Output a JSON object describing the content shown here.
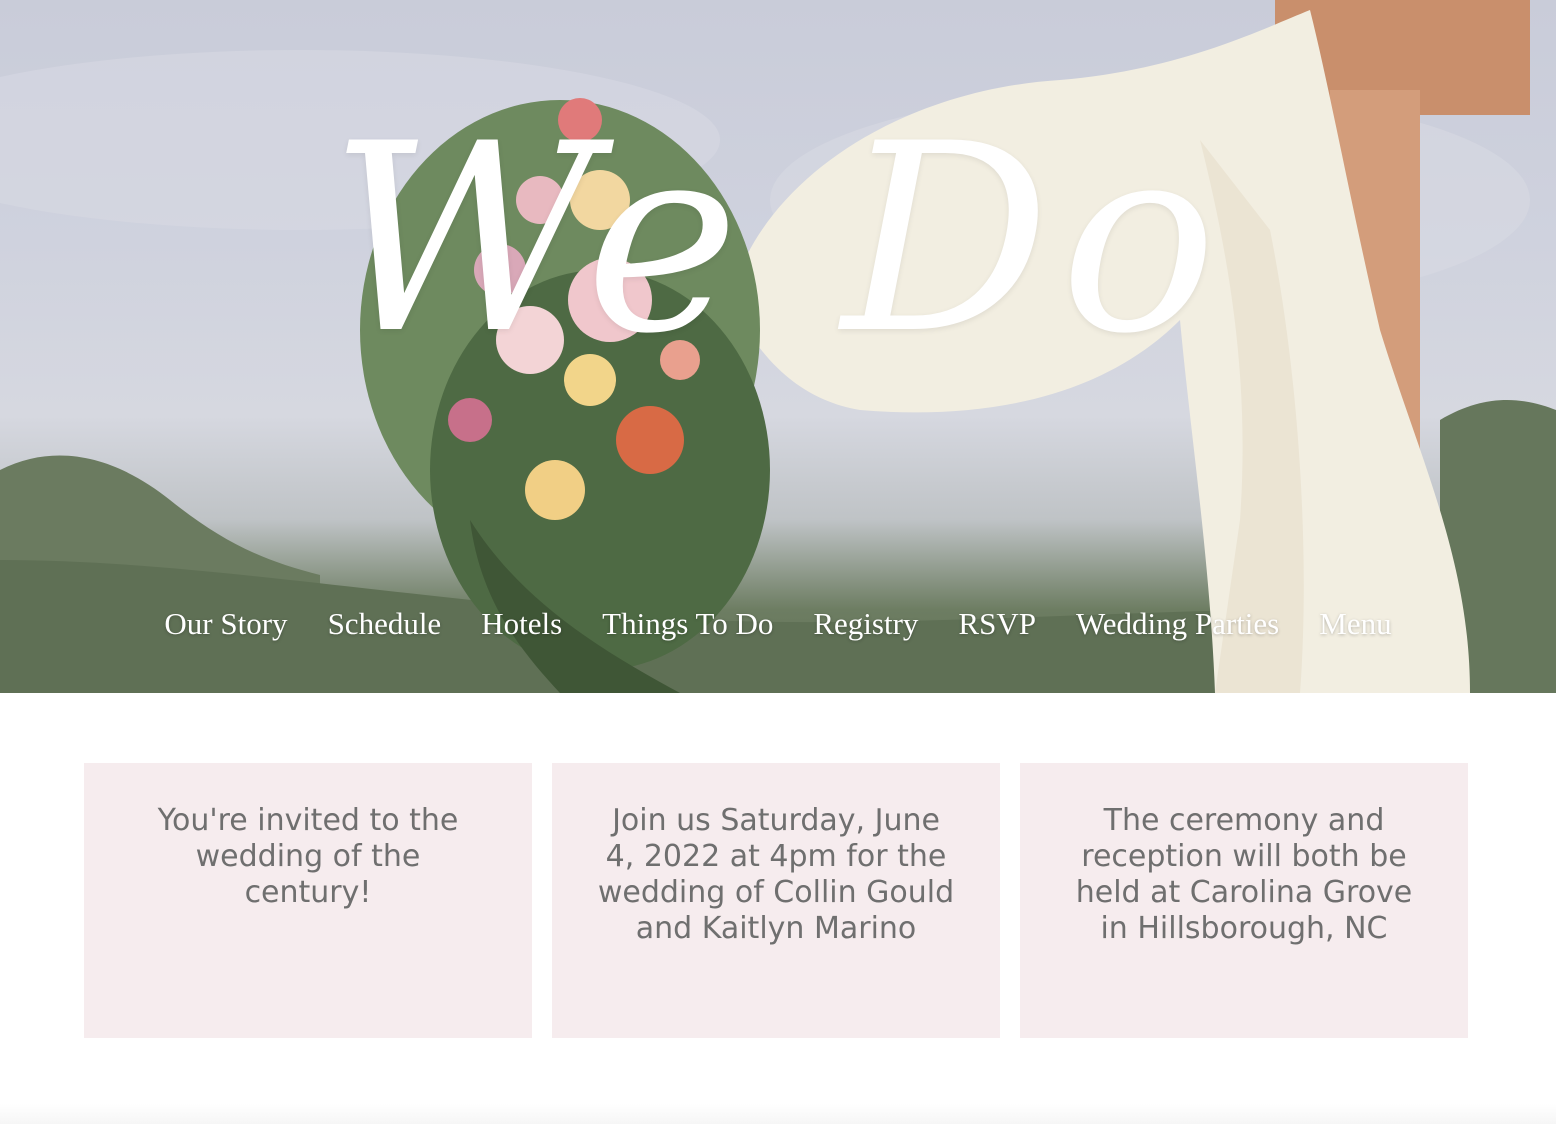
{
  "hero": {
    "title": "We Do"
  },
  "nav": {
    "items": [
      {
        "label": "Our Story"
      },
      {
        "label": "Schedule"
      },
      {
        "label": "Hotels"
      },
      {
        "label": "Things To Do"
      },
      {
        "label": "Registry"
      },
      {
        "label": "RSVP"
      },
      {
        "label": "Wedding Parties"
      },
      {
        "label": "Menu"
      }
    ]
  },
  "cards": [
    {
      "text": "You're invited to the wedding of the century!"
    },
    {
      "text": "Join us Saturday, June 4, 2022 at 4pm for the wedding of Collin Gould and Kaitlyn Marino"
    },
    {
      "text": "The ceremony and reception will both be held at Carolina Grove in Hillsborough, NC"
    }
  ],
  "colors": {
    "card_background": "#f6ecee",
    "card_text": "#6f6f6f",
    "nav_text": "#ffffff",
    "title_text": "#ffffff"
  }
}
